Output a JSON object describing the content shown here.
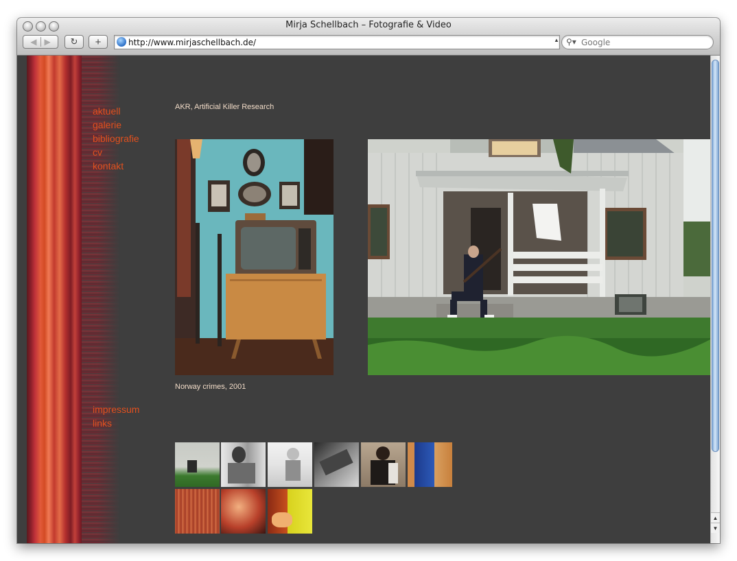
{
  "window": {
    "title": "Mirja Schellbach – Fotografie & Video"
  },
  "toolbar": {
    "url": "http://www.mirjaschellbach.de/",
    "search_placeholder": "Google"
  },
  "nav": {
    "main": [
      "aktuell",
      "galerie",
      "bibliografie",
      "cv",
      "kontakt"
    ],
    "footer": [
      "impressum",
      "links"
    ]
  },
  "page": {
    "title": "AKR, Artificial Killer Research",
    "caption": "Norway crimes, 2001"
  },
  "gallery": {
    "thumbnail_count": 9
  },
  "colors": {
    "background": "#3e3e3e",
    "nav_link": "#e2501e",
    "text": "#f2dcc8"
  }
}
